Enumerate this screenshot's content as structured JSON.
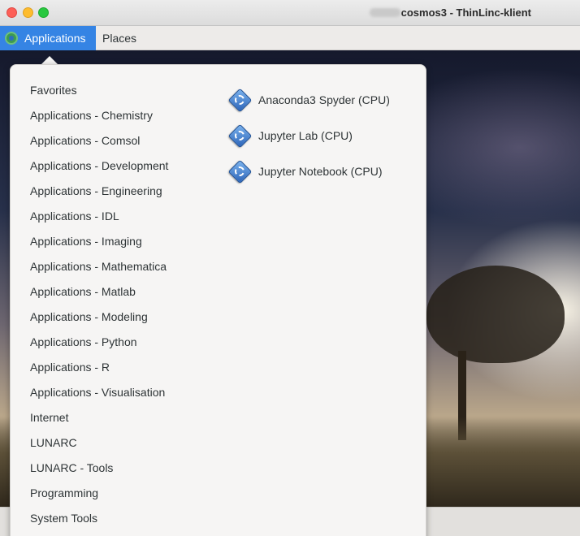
{
  "window": {
    "title_suffix": "cosmos3 - ThinLinc-klient"
  },
  "panel": {
    "applications_label": "Applications",
    "places_label": "Places"
  },
  "menu": {
    "categories": [
      "Favorites",
      "Applications - Chemistry",
      "Applications - Comsol",
      "Applications - Development",
      "Applications - Engineering",
      "Applications - IDL",
      "Applications - Imaging",
      "Applications - Mathematica",
      "Applications - Matlab",
      "Applications - Modeling",
      "Applications - Python",
      "Applications - R",
      "Applications - Visualisation",
      "Internet",
      "LUNARC",
      "LUNARC - Tools",
      "Programming",
      "System Tools"
    ],
    "apps": [
      {
        "label": "Anaconda3 Spyder (CPU)",
        "icon": "spyder-app-icon"
      },
      {
        "label": "Jupyter Lab (CPU)",
        "icon": "jupyter-app-icon"
      },
      {
        "label": "Jupyter Notebook (CPU)",
        "icon": "jupyter-app-icon"
      }
    ]
  },
  "colors": {
    "accent": "#3584e4",
    "menu_bg": "#f6f5f4"
  }
}
